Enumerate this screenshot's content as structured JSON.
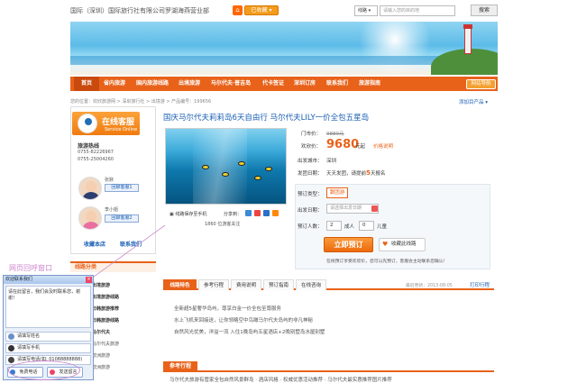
{
  "header": {
    "site_title": "国际（深圳）国际旅行社有限公司罗湖海燕营业部",
    "home_badge": "⌂",
    "fav_badge": "已收藏 ▾",
    "search_select": "线路 ▾",
    "search_placeholder": "请输入您的目的地",
    "search_button": "搜索"
  },
  "nav": {
    "items": [
      "首页",
      "省内旅游",
      "国内旅游线路",
      "出境旅游",
      "马尔代夫·普吉岛",
      "代卡签证",
      "深圳订房",
      "联系我们",
      "旅游指南"
    ],
    "right_button": "网站导航"
  },
  "breadcrumb": {
    "text": "您的位置：欢欣旅游网 > 深圳旅行社 > 出境游 > 产品编号：199656",
    "right_link": "添加目产品 ▾"
  },
  "sidebar": {
    "cs_title": "在线客服",
    "cs_subtitle": "Service Online",
    "hotline_label": "旅游热线",
    "phones": [
      "0755-82226967",
      "0755-25004260"
    ],
    "agents": [
      {
        "name": "张默",
        "button": "回聊客服1"
      },
      {
        "name": "李小姐",
        "button": "回聊客服2"
      }
    ],
    "links": [
      "收藏本店",
      "联系我们"
    ],
    "route_category": "线路分类",
    "routes": [
      "出境旅游",
      "出境旅游线路",
      "日韩旅游推荐",
      "日韩旅游线路",
      "马尔代夫",
      "马尔代夫旅游",
      "欧洲旅游",
      "欧洲旅游"
    ]
  },
  "product": {
    "title": "国庆马尔代夫莉莉岛6天自由行 马尔代夫LILY一价全包五星岛",
    "market_price_label": "门市价：",
    "market_price": "9880元",
    "our_price_label": "欢欣价：",
    "our_price": "9680",
    "price_unit": "元起",
    "price_note": "价格说明",
    "depart_city_label": "出发城市：",
    "depart_city": "深圳",
    "depart_date_label": "发团日期：",
    "depart_date_prefix": "天天发团，请提前",
    "depart_days": "5",
    "depart_date_suffix": "天报名",
    "image_caption1": "▣ 线路保存至手机",
    "image_caption2": "分享到：",
    "image_caption3": "1860 位游客关注"
  },
  "booking": {
    "type_label": "预订类型：",
    "type_value": "跟团游",
    "date_label": "出发日期：",
    "date_placeholder": "请选择出发日期",
    "people_label": "预订人数：",
    "adults_value": "2",
    "adults_label": "成人",
    "children_value": "0",
    "children_label": "儿童",
    "book_button": "立即预订",
    "fav_button": "收藏此线路",
    "tip": "在线预订享受欢欣价，您可以先预订，客服会主动联系您确认！"
  },
  "tabs": {
    "items": [
      "线路特色",
      "参考行程",
      "费用说明",
      "预订指南",
      "在线咨询"
    ],
    "meta": "最后更新：2013-08-05",
    "print": "打印行程"
  },
  "features": [
    "全新超5星奢华岛屿，尊享白金一价全包至尊服务",
    "水上飞机来回接送，让你领略空中鸟瞰马尔代夫岛屿的非凡神秘",
    "自然风光优美，洋溢一流 入住1晚岛屿五星酒店+2晚别墅岛水屋别墅"
  ],
  "itinerary": {
    "heading": "参考行程",
    "line": "马尔代夫旅游有管家全包自然风景群岛 · 酒店风格 · 权威优惠活动推荐 · 马尔代夫最实惠推荐图片推荐"
  },
  "chat_popup": {
    "annotation": "网页回呼窗口",
    "header": "欢迎联系我们",
    "close": "×",
    "message": "请在此留言，我们会及时联系您，谢谢！",
    "name_placeholder": "请填写姓名",
    "phone_placeholder": "请填写手机",
    "tel_placeholder": "请填写电话(如: 01088888888)",
    "call_button": "免费电话",
    "send_button": "发送留言"
  },
  "colors": {
    "brand_orange": "#e8621a",
    "link_blue": "#1a5fb4",
    "annotation_pink": "#cc88cc"
  }
}
